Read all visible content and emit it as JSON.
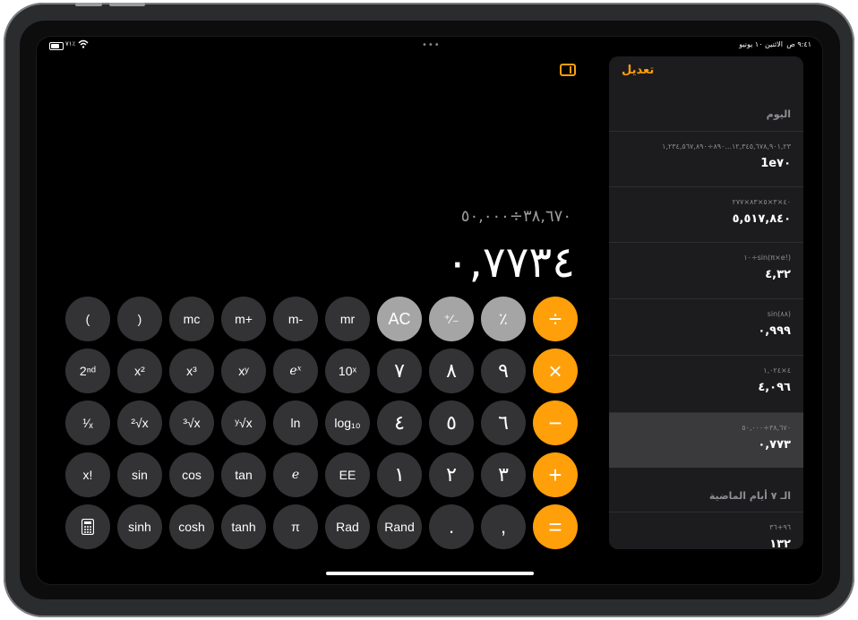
{
  "status_bar": {
    "battery": "٧١٪",
    "time": "٩:٤١ ص",
    "date": "الاثنين ١٠ يونيو",
    "dots": "•••"
  },
  "display": {
    "expression": "٣٨,٦٧٠÷٥٠,٠٠٠",
    "result": "٠,٧٧٣٤"
  },
  "keys": {
    "open_paren": "(",
    "close_paren": ")",
    "mc": "mc",
    "m_plus": "m+",
    "m_minus": "m-",
    "mr": "mr",
    "clear": "AC",
    "plus_minus": "⁺⁄₋",
    "percent": "٪",
    "divide": "÷",
    "second": "2ⁿᵈ",
    "x_squared": "x²",
    "x_cubed": "x³",
    "x_power_y": "xʸ",
    "e_power_x": "eˣ",
    "ten_power_x": "10ˣ",
    "seven": "٧",
    "eight": "٨",
    "nine": "٩",
    "multiply": "×",
    "reciprocal": "¹⁄ₓ",
    "square_root": "²√x",
    "cube_root": "³√x",
    "y_root": "ʸ√x",
    "ln": "ln",
    "log10": "log₁₀",
    "four": "٤",
    "five": "٥",
    "six": "٦",
    "minus": "−",
    "factorial": "x!",
    "sin": "sin",
    "cos": "cos",
    "tan": "tan",
    "e": "e",
    "ee": "EE",
    "one": "١",
    "two": "٢",
    "three": "٣",
    "plus": "+",
    "sinh": "sinh",
    "cosh": "cosh",
    "tanh": "tanh",
    "pi": "π",
    "rad": "Rad",
    "rand": "Rand",
    "decimal": ".",
    "thousands": ",",
    "equals": "="
  },
  "history": {
    "edit_label": "تعديل",
    "today_label": "اليوم",
    "past_label": "الـ ٧ أيام الماضية",
    "items": [
      {
        "expression": "١٢,٣٤٥,٦٧٨,٩٠١,٢٣...٨٩٠÷١,٢٣٤,٥٦٧,٨٩٠",
        "result": "1e٧٠"
      },
      {
        "expression": "٤٠×٣×٥×٨٣×٢٧٧",
        "result": "٥,٥١٧,٨٤٠"
      },
      {
        "expression": "١٠÷sin(π×e!)",
        "result": "٤,٣٢"
      },
      {
        "expression": "sin(٨٨)",
        "result": "٠,٩٩٩"
      },
      {
        "expression": "٤×١,٠٢٤",
        "result": "٤,٠٩٦"
      },
      {
        "expression": "٣٨,٦٧٠÷٥٠,٠٠٠",
        "result": "٠,٧٧٣"
      },
      {
        "expression": "٩٦+٣٦",
        "result": "١٣٢"
      }
    ]
  },
  "colors": {
    "accent": "#ff9f0a",
    "key_dark": "#333335",
    "key_light": "#a5a5a5",
    "panel": "#1c1c1e",
    "active_row": "#3a3a3c"
  }
}
